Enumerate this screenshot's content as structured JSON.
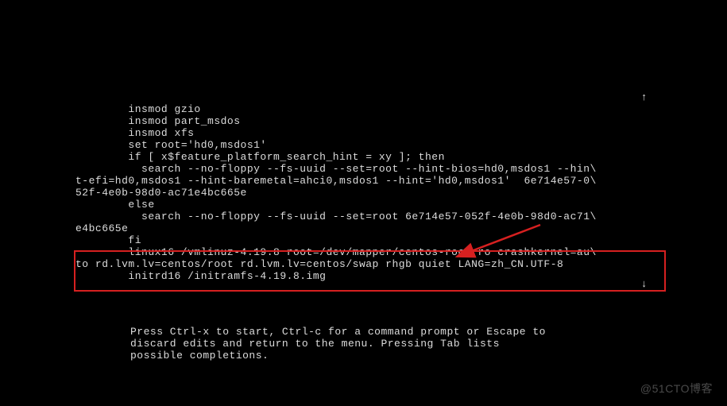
{
  "grub": {
    "lines": [
      "        insmod gzio",
      "        insmod part_msdos",
      "        insmod xfs",
      "        set root='hd0,msdos1'",
      "        if [ x$feature_platform_search_hint = xy ]; then",
      "          search --no-floppy --fs-uuid --set=root --hint-bios=hd0,msdos1 --hin\\",
      "t-efi=hd0,msdos1 --hint-baremetal=ahci0,msdos1 --hint='hd0,msdos1'  6e714e57-0\\",
      "52f-4e0b-98d0-ac71e4bc665e",
      "        else",
      "          search --no-floppy --fs-uuid --set=root 6e714e57-052f-4e0b-98d0-ac71\\",
      "e4bc665e",
      "        fi",
      "        linux16 /vmlinuz-4.19.8 root=/dev/mapper/centos-root ro crashkernel=au\\",
      "to rd.lvm.lv=centos/root rd.lvm.lv=centos/swap rhgb quiet LANG=zh_CN.UTF-8",
      "        initrd16 /initramfs-4.19.8.img"
    ],
    "footer": [
      "Press Ctrl-x to start, Ctrl-c for a command prompt or Escape to",
      "discard edits and return to the menu. Pressing Tab lists",
      "possible completions."
    ],
    "scroll_up": "↑",
    "scroll_down": "↓"
  },
  "watermark": "@51CTO博客"
}
